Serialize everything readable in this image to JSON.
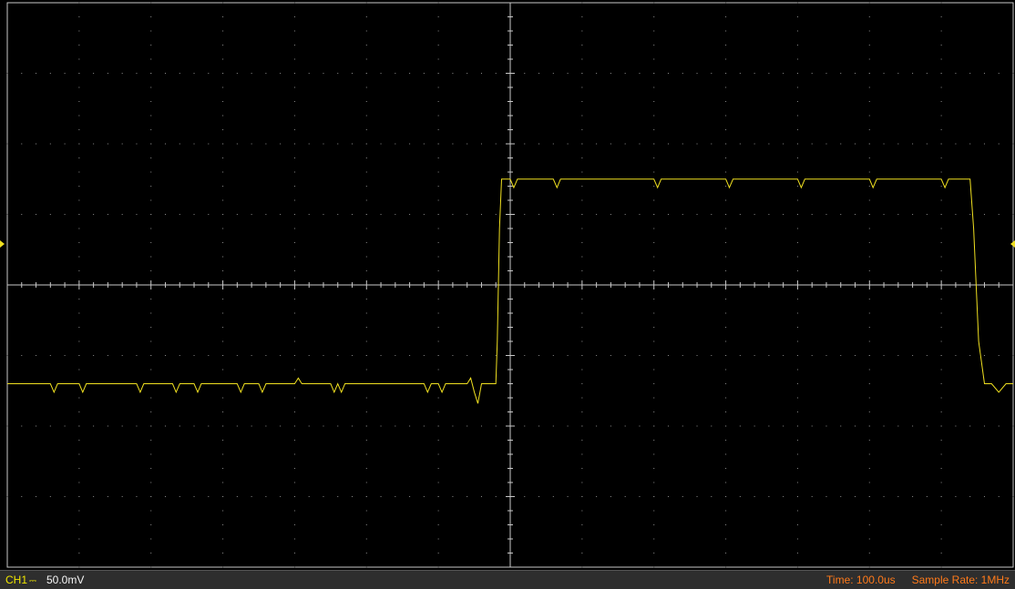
{
  "status_bar": {
    "channel_label": "CH1",
    "coupling_icon": "dc-coupling-icon",
    "channel_scale": "50.0mV",
    "time_base": "Time: 100.0us",
    "sample_rate": "Sample Rate: 1MHz"
  },
  "colors": {
    "background": "#000000",
    "grid": "#c8c8c8",
    "trace": "#f0e020",
    "channel_text": "#f0e600",
    "info_text": "#ff7a1a",
    "status_bar": "#2e2e2e"
  },
  "chart_data": {
    "type": "line",
    "title": "",
    "xlabel": "",
    "ylabel": "",
    "x_divisions": 14,
    "y_divisions": 8,
    "grid": true,
    "x_unit": "us",
    "y_unit": "mV",
    "xlim": [
      -700,
      700
    ],
    "ylim": [
      -200,
      200
    ],
    "series": [
      {
        "name": "CH1",
        "x": [
          -700,
          -640,
          -635,
          -630,
          -600,
          -595,
          -590,
          -520,
          -515,
          -510,
          -470,
          -465,
          -460,
          -440,
          -435,
          -430,
          -380,
          -375,
          -370,
          -350,
          -345,
          -340,
          -300,
          -295,
          -290,
          -250,
          -245,
          -240,
          -235,
          -230,
          -120,
          -115,
          -110,
          -100,
          -95,
          -90,
          -60,
          -55,
          -50,
          -45,
          -40,
          -35,
          -20,
          -18,
          -15,
          -12,
          0,
          5,
          10,
          60,
          65,
          70,
          200,
          205,
          210,
          300,
          305,
          310,
          400,
          405,
          410,
          500,
          505,
          510,
          600,
          605,
          610,
          640,
          645,
          652,
          660,
          670,
          680,
          690,
          700
        ],
        "values": [
          -70,
          -70,
          -76,
          -70,
          -70,
          -76,
          -70,
          -70,
          -76,
          -70,
          -70,
          -76,
          -70,
          -70,
          -76,
          -70,
          -70,
          -76,
          -70,
          -70,
          -76,
          -70,
          -70,
          -66,
          -70,
          -70,
          -76,
          -70,
          -76,
          -70,
          -70,
          -76,
          -70,
          -70,
          -76,
          -70,
          -70,
          -66,
          -76,
          -84,
          -70,
          -70,
          -70,
          -40,
          40,
          75,
          75,
          69,
          75,
          75,
          69,
          75,
          75,
          69,
          75,
          75,
          69,
          75,
          75,
          69,
          75,
          75,
          69,
          75,
          75,
          69,
          75,
          75,
          40,
          -40,
          -70,
          -70,
          -76,
          -70,
          -70
        ]
      }
    ]
  }
}
